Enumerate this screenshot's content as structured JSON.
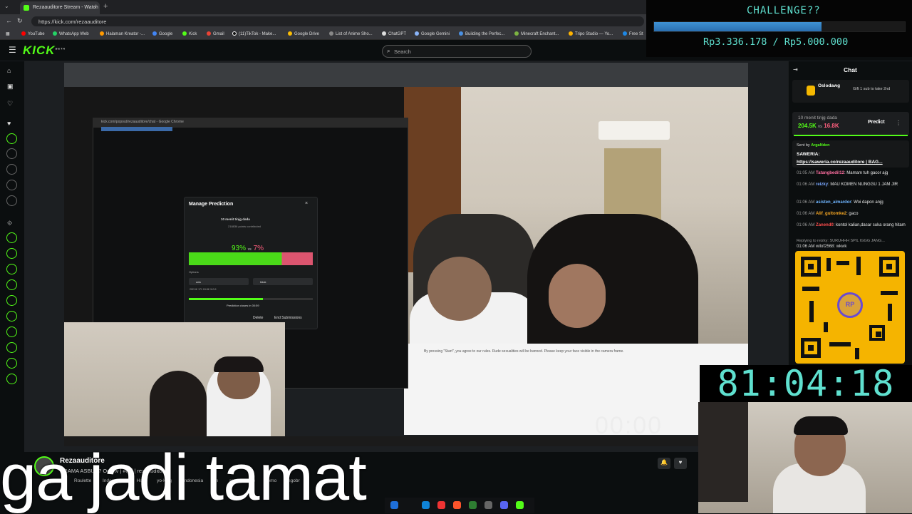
{
  "browser": {
    "tab_title": "Rezaauditore Stream - Watch",
    "url": "https://kick.com/rezaauditore",
    "bookmarks": [
      "YouTube",
      "WhatsApp Web",
      "Halaman Kreator -...",
      "Google",
      "Kick",
      "Gmail",
      "(11)TikTok - Make...",
      "Google Drive",
      "List of Anime Sho...",
      "ChatGPT",
      "Google Gemini",
      "Building the Perfec...",
      "Minecraft Enchant...",
      "Tripo Studio — Yo...",
      "Free St"
    ]
  },
  "kick": {
    "logo": "KICK",
    "logo_badge": "BETA",
    "search_placeholder": "Search"
  },
  "overlay": {
    "challenge_title": "CHALLENGE??",
    "challenge_progress": 0.667,
    "challenge_amount": "Rp3.336.178 / Rp5.000.000",
    "timer": "81:04:18",
    "caption": "ga jadi tamat",
    "faint_timer": "00:00"
  },
  "prediction_modal": {
    "title": "Manage Prediction",
    "question": "10 menit tinjg dada",
    "points": "218836 points contributed",
    "pct_left": "93%",
    "vs": "vs",
    "pct_right": "7%",
    "options_label": "Options",
    "option1": "ada",
    "option2": "tidak",
    "stats": "202.9K  171   15.8K  110.9",
    "closes": "Prediction closes in 00:59",
    "delete": "Delete",
    "end": "End Submissions"
  },
  "inner_browser": {
    "popup_title": "kick.com/popout/rezaauditore/chat - Google Chrome",
    "terms": "By pressing \"Start\", you agree to our rules. Rude sexualities will be banned. Please keep your face visible in the camera frame."
  },
  "stream_info": {
    "streamer": "Rezaauditore",
    "title": "DRAMA ASBUN? Oo | tv | #ictf | rezaauditore",
    "tags": [
      "Roulette",
      "Indonesian",
      "Horr",
      "yo-king",
      "Indonesia",
      "m",
      "rezaauditore",
      "jomo",
      "ngobr"
    ]
  },
  "chat": {
    "title": "Chat",
    "gift_user": "Oslodawg",
    "gift_text": "Gift 1 sub to take 2nd",
    "prediction_question": "10 menit tinjg dada",
    "prediction_left": "204.5K",
    "prediction_vs": "vs",
    "prediction_right": "16.8K",
    "predict_button": "Predict",
    "pinned_sender": "Sent by",
    "pinned_user": "ArgaNden",
    "pinned_line1": "SAWERIA:",
    "pinned_line2": "https://saweria.co/rezaauditore | BAG...",
    "messages": [
      {
        "time": "01:05 AM",
        "user": "Tatangbedil12",
        "color": "#ff6fa1",
        "text": "Mamam tuh gacor ajg"
      },
      {
        "time": "01:06 AM",
        "user": "reizky",
        "color": "#7aa7ff",
        "text": "MAU KOMEN NUNGGU 1 JAM JIR"
      },
      {
        "time": "01:06 AM",
        "user": "asisten_aimardor",
        "color": "#6fb5ff",
        "text": "Woi dapon anjg"
      },
      {
        "time": "01:06 AM",
        "user": "Alif_gultomke2",
        "color": "#f5a623",
        "text": "gaco"
      },
      {
        "time": "01:06 AM",
        "user": "Zanend0",
        "color": "#ff4d4d",
        "text": "kontol kalian,dasar suka orang hitam"
      }
    ],
    "reply_note": "Replying to reizky: SURUHHH SPIL IGGG JANG...",
    "reply_msg": "01:06 AM  wilof2568: wkwk"
  }
}
